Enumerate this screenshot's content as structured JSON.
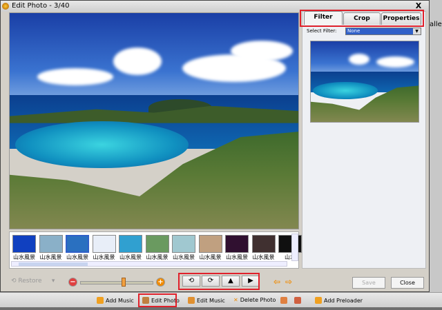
{
  "window": {
    "title": "Edit Photo - 3/40",
    "close": "X"
  },
  "background_app": {
    "text": "alle"
  },
  "tabs": [
    {
      "label": "Filter",
      "active": true
    },
    {
      "label": "Crop",
      "active": false
    },
    {
      "label": "Properties",
      "active": false
    }
  ],
  "filter": {
    "label": "Select Filter:",
    "value": "None"
  },
  "filmstrip": {
    "items": [
      {
        "label": "山水風景",
        "color": "#1040c0"
      },
      {
        "label": "山水風景",
        "color": "#8ab0c8"
      },
      {
        "label": "山水風景",
        "color": "#2a70c0",
        "selected": true
      },
      {
        "label": "山水風景",
        "color": "#e8eef8"
      },
      {
        "label": "山水風景",
        "color": "#30a0d0"
      },
      {
        "label": "山水風景",
        "color": "#6a9a60"
      },
      {
        "label": "山水風景",
        "color": "#a0c8d0"
      },
      {
        "label": "山水風景",
        "color": "#c0a080"
      },
      {
        "label": "山水風景",
        "color": "#301030"
      },
      {
        "label": "山水風景",
        "color": "#403030"
      },
      {
        "label": "山水",
        "color": "#101010"
      }
    ]
  },
  "toolbar": {
    "restore": "Restore",
    "zoom_value": 0.63,
    "save": "Save",
    "close": "Close"
  },
  "taskbar": {
    "items": [
      "Add Music",
      "Edit Photo",
      "Edit Music",
      "Delete Photo",
      "Add Preloader"
    ]
  },
  "colors": {
    "highlight": "#e0202a",
    "accent": "#f08a00"
  }
}
